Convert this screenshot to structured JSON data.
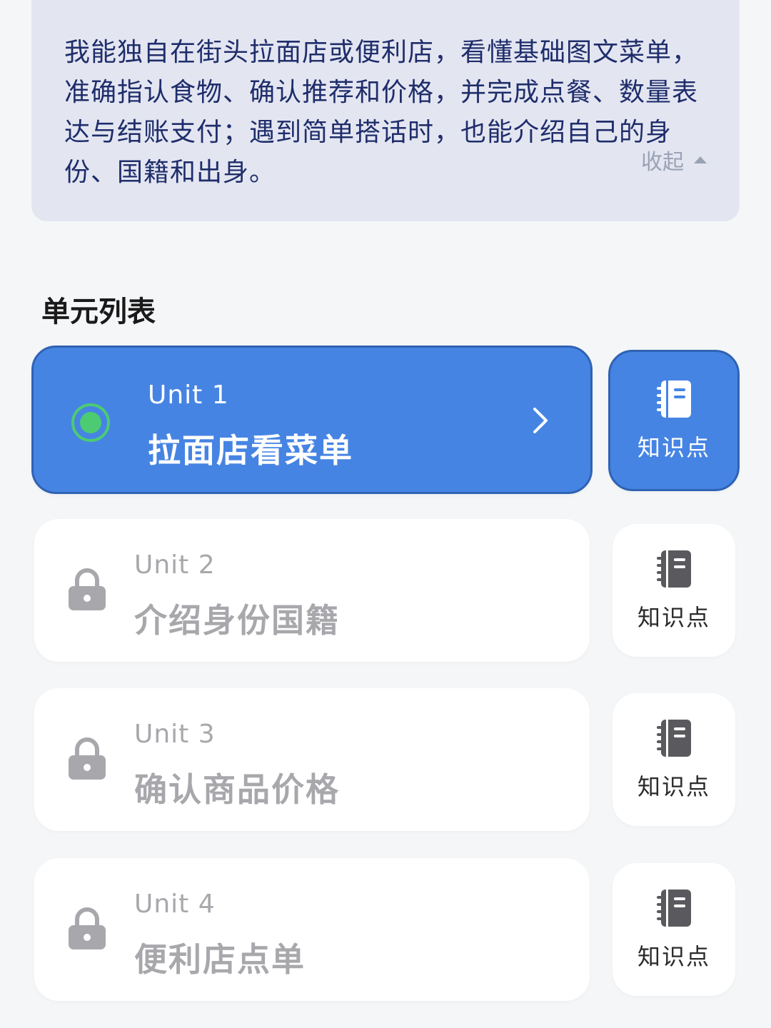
{
  "goal": {
    "text": "我能独自在街头拉面店或便利店，看懂基础图文菜单，准确指认食物、确认推荐和价格，并完成点餐、数量表达与结账支付；遇到简单搭话时，也能介绍自己的身份、国籍和出身。",
    "collapse_label": "收起"
  },
  "section": {
    "title": "单元列表"
  },
  "units": [
    {
      "code": "Unit 1",
      "title": "拉面店看菜单",
      "status": "current",
      "kp_label": "知识点"
    },
    {
      "code": "Unit 2",
      "title": "介绍身份国籍",
      "status": "locked",
      "kp_label": "知识点"
    },
    {
      "code": "Unit 3",
      "title": "确认商品价格",
      "status": "locked",
      "kp_label": "知识点"
    },
    {
      "code": "Unit 4",
      "title": "便利店点单",
      "status": "locked",
      "kp_label": "知识点"
    }
  ],
  "colors": {
    "accent": "#4684e3",
    "accent_border": "#2f63b3",
    "current_dot": "#4ccb73",
    "locked_gray": "#a8a8ac",
    "goal_bg": "#e3e6f1",
    "goal_text": "#1f2d6b"
  }
}
